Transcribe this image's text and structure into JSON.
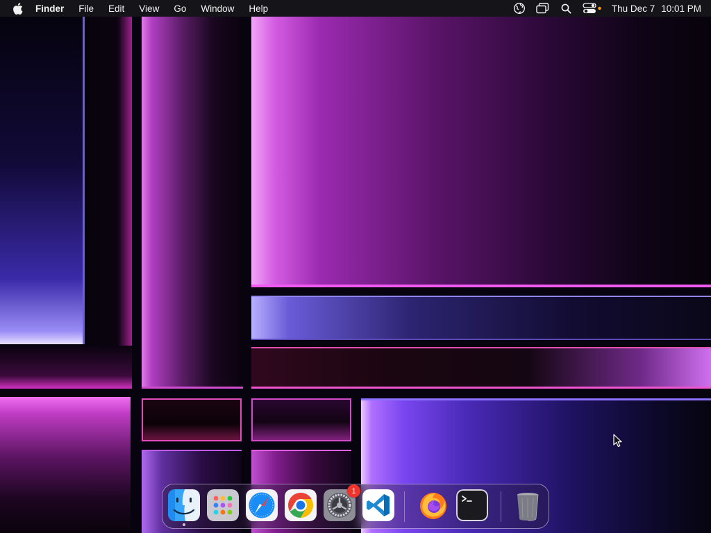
{
  "menubar": {
    "apple_icon": "apple-logo",
    "app_name": "Finder",
    "menus": [
      "File",
      "Edit",
      "View",
      "Go",
      "Window",
      "Help"
    ],
    "status_icons": [
      "vpn-globe-icon",
      "screen-mirroring-icon",
      "spotlight-search-icon",
      "control-center-icon"
    ],
    "privacy_indicator_color": "#ff9f0a",
    "date": "Thu Dec 7",
    "time": "10:01 PM"
  },
  "dock": {
    "apps": [
      {
        "name": "Finder",
        "icon": "finder-icon",
        "running": true
      },
      {
        "name": "Launchpad",
        "icon": "launchpad-icon",
        "running": false
      },
      {
        "name": "Safari",
        "icon": "safari-icon",
        "running": false
      },
      {
        "name": "Google Chrome",
        "icon": "chrome-icon",
        "running": false
      },
      {
        "name": "System Settings",
        "icon": "system-settings-icon",
        "running": false,
        "badge": "1"
      },
      {
        "name": "Visual Studio Code",
        "icon": "vscode-icon",
        "running": false
      },
      {
        "name": "Firefox",
        "icon": "firefox-icon",
        "running": false
      },
      {
        "name": "Terminal",
        "icon": "terminal-icon",
        "running": false
      },
      {
        "name": "Trash",
        "icon": "trash-icon",
        "running": false
      }
    ],
    "badge_color": "#f0342c"
  },
  "colors": {
    "menubar_bg": "#16161a",
    "wallpaper_accent_pink": "#f05af0",
    "wallpaper_accent_violet": "#7a46f0"
  }
}
